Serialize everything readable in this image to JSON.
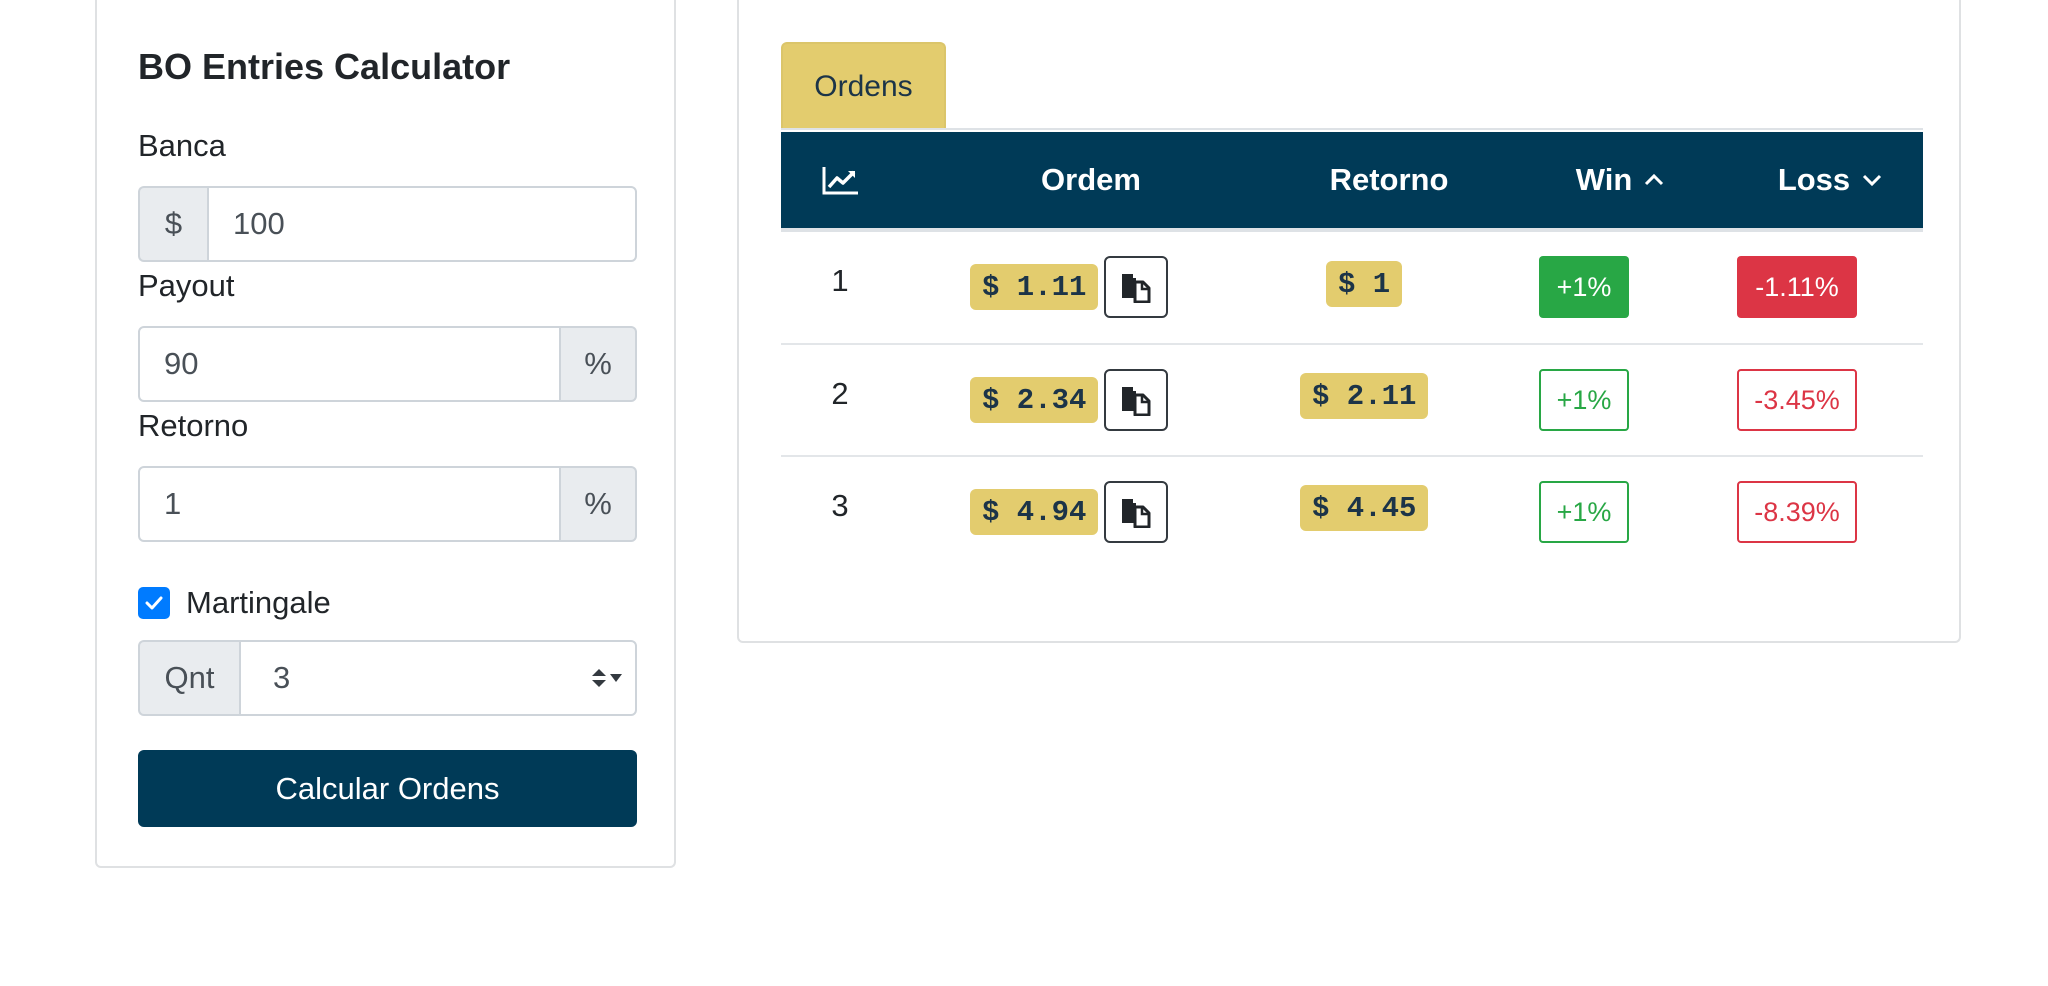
{
  "calculator": {
    "title": "BO Entries Calculator",
    "banca": {
      "label": "Banca",
      "prefix": "$",
      "value": "100"
    },
    "payout": {
      "label": "Payout",
      "value": "90",
      "suffix": "%"
    },
    "retorno": {
      "label": "Retorno",
      "value": "1",
      "suffix": "%"
    },
    "martingale": {
      "label": "Martingale",
      "checked": true
    },
    "qnt": {
      "prefix": "Qnt",
      "value": "3"
    },
    "button_label": "Calcular Ordens"
  },
  "results": {
    "tab_label": "Ordens",
    "columns": [
      "Ordem",
      "Retorno",
      "Win",
      "Loss"
    ],
    "header_icon": "chart-line-icon",
    "rows": [
      {
        "n": "1",
        "ordem": "$ 1.11",
        "retorno": "$ 1",
        "win": "+1%",
        "loss": "-1.11%"
      },
      {
        "n": "2",
        "ordem": "$ 2.34",
        "retorno": "$ 2.11",
        "win": "+1%",
        "loss": "-3.45%"
      },
      {
        "n": "3",
        "ordem": "$ 4.94",
        "retorno": "$ 4.45",
        "win": "+1%",
        "loss": "-8.39%"
      }
    ]
  },
  "colors": {
    "primary_dark": "#003a57",
    "gold": "#e3cc6e",
    "success": "#28a745",
    "danger": "#dc3545",
    "checkbox": "#007bff"
  }
}
